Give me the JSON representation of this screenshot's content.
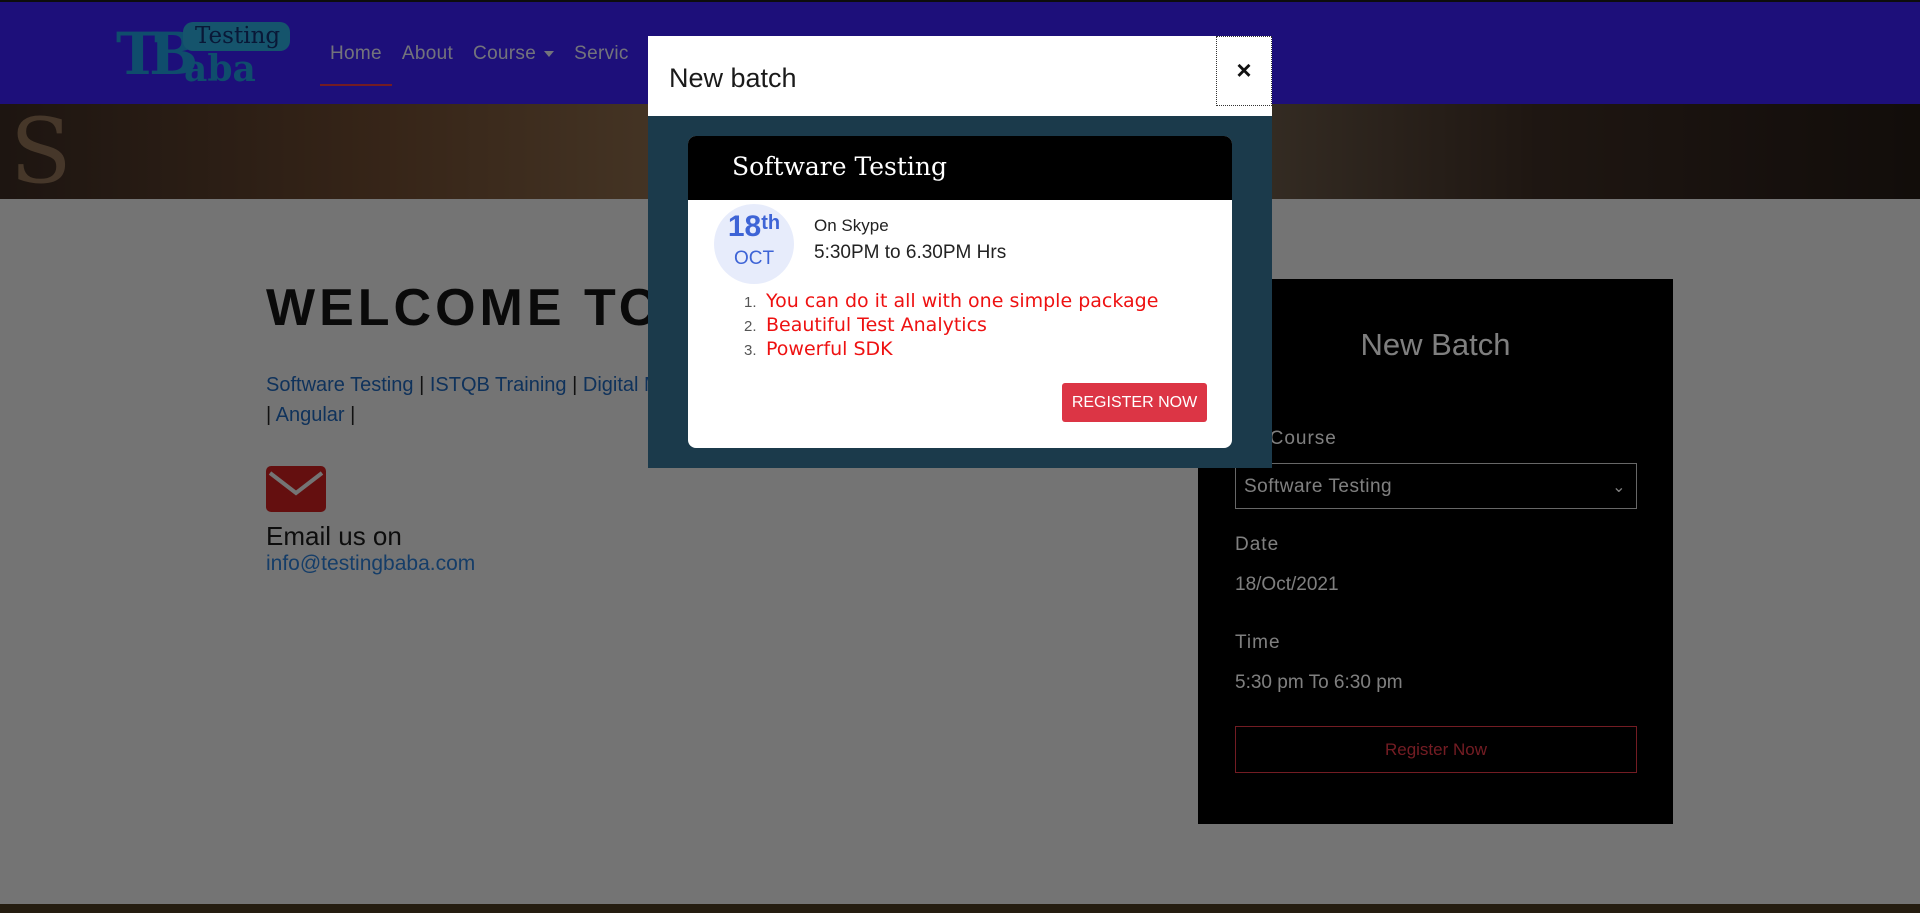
{
  "brand": {
    "logo_tb": "TB",
    "logo_testing": "Testing",
    "logo_aba": "aba"
  },
  "nav": {
    "items": [
      {
        "label": "Home"
      },
      {
        "label": "About"
      },
      {
        "label": "Course"
      },
      {
        "label": "Servic"
      }
    ],
    "active_color": "#e63946",
    "bar_color": "#3a1ef5"
  },
  "main": {
    "welcome": "WELCOME TO",
    "links": [
      "Software Testing",
      "ISTQB Training",
      "Digital M",
      "Angular"
    ],
    "separator": "|",
    "email_label": "Email us on",
    "email": "info@testingbaba.com"
  },
  "panel": {
    "title": "New Batch",
    "course_label": "ect Course",
    "course_value": "Software Testing",
    "date_label": "Date",
    "date_value": "18/Oct/2021",
    "time_label": "Time",
    "time_value": "5:30 pm To 6:30 pm",
    "register_label": "Register Now"
  },
  "modal": {
    "title": "New batch",
    "close": "×",
    "card": {
      "heading": "Software Testing",
      "day": "18",
      "day_suffix": "th",
      "month": "OCT",
      "where": "On Skype",
      "time": "5:30PM to 6.30PM Hrs",
      "features": [
        {
          "num": "1.",
          "text": "You can do it all with one simple package"
        },
        {
          "num": "2.",
          "text": "Beautiful Test Analytics"
        },
        {
          "num": "3.",
          "text": "Powerful SDK"
        }
      ],
      "register_label": "REGISTER NOW"
    }
  }
}
